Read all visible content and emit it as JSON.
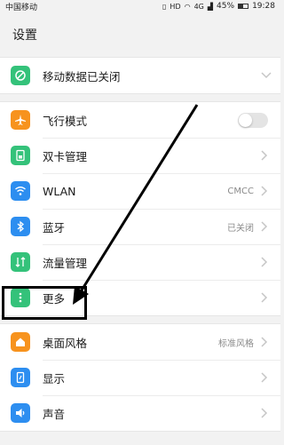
{
  "status": {
    "carrier": "中国移动",
    "battery": "45%",
    "battery_level": 0.45,
    "time": "19:28",
    "network": "4G"
  },
  "header": {
    "title": "设置"
  },
  "groups": [
    {
      "items": [
        {
          "label": "移动数据已关闭",
          "icon": "mobile-data-icon",
          "color": "#34c27a"
        }
      ]
    },
    {
      "items": [
        {
          "label": "飞行模式",
          "icon": "airplane-icon",
          "color": "#f7931e"
        },
        {
          "label": "双卡管理",
          "icon": "sim-card-icon",
          "color": "#34c27a"
        },
        {
          "label": "WLAN",
          "value": "CMCC",
          "icon": "wifi-icon",
          "color": "#2d8ef0"
        },
        {
          "label": "蓝牙",
          "value": "已关闭",
          "icon": "bluetooth-icon",
          "color": "#2d8ef0"
        },
        {
          "label": "流量管理",
          "icon": "data-usage-icon",
          "color": "#34c27a"
        },
        {
          "label": "更多",
          "icon": "more-dots-icon",
          "color": "#34c27a"
        }
      ]
    },
    {
      "items": [
        {
          "label": "桌面风格",
          "value": "标准风格",
          "icon": "home-style-icon",
          "color": "#f7931e"
        },
        {
          "label": "显示",
          "icon": "display-icon",
          "color": "#2d8ef0"
        },
        {
          "label": "声音",
          "icon": "sound-icon",
          "color": "#2d8ef0"
        }
      ]
    }
  ]
}
